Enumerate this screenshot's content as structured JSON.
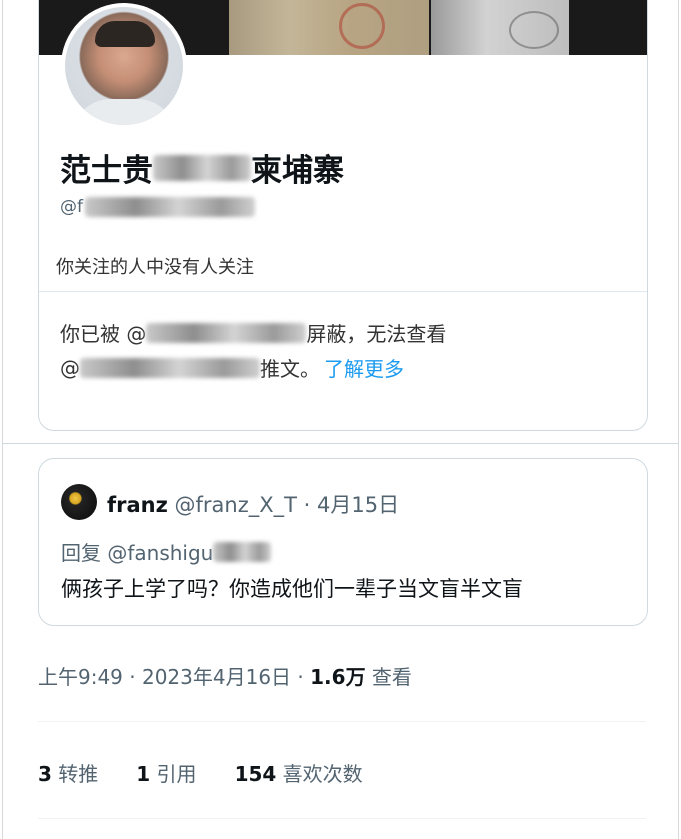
{
  "profile": {
    "name_prefix": "范士贵",
    "name_suffix": "柬埔寨",
    "handle_prefix": "@f",
    "follow_note": "你关注的人中没有人关注",
    "blocked_line1_prefix": "你已被 @",
    "blocked_line1_suffix": "屏蔽，无法查看",
    "blocked_line2_prefix": "@",
    "blocked_line2_suffix": "推文。",
    "learn_more": "了解更多"
  },
  "reply": {
    "author_name": "franz",
    "author_handle_date": "@franz_X_T · 4月15日",
    "reply_to_prefix": "回复 @fanshigu",
    "text": "俩孩子上学了吗？你造成他们一辈子当文盲半文盲"
  },
  "meta": {
    "time_date": "上午9:49 · 2023年4月16日 · ",
    "views_count": "1.6万",
    "views_label": " 查看"
  },
  "stats": {
    "retweets_count": "3",
    "retweets_label": " 转推",
    "quotes_count": "1",
    "quotes_label": " 引用",
    "likes_count": "154",
    "likes_label": " 喜欢次数"
  },
  "colors": {
    "link": "#1d9bf0",
    "secondary_text": "#536471",
    "border": "#cfd9de"
  }
}
